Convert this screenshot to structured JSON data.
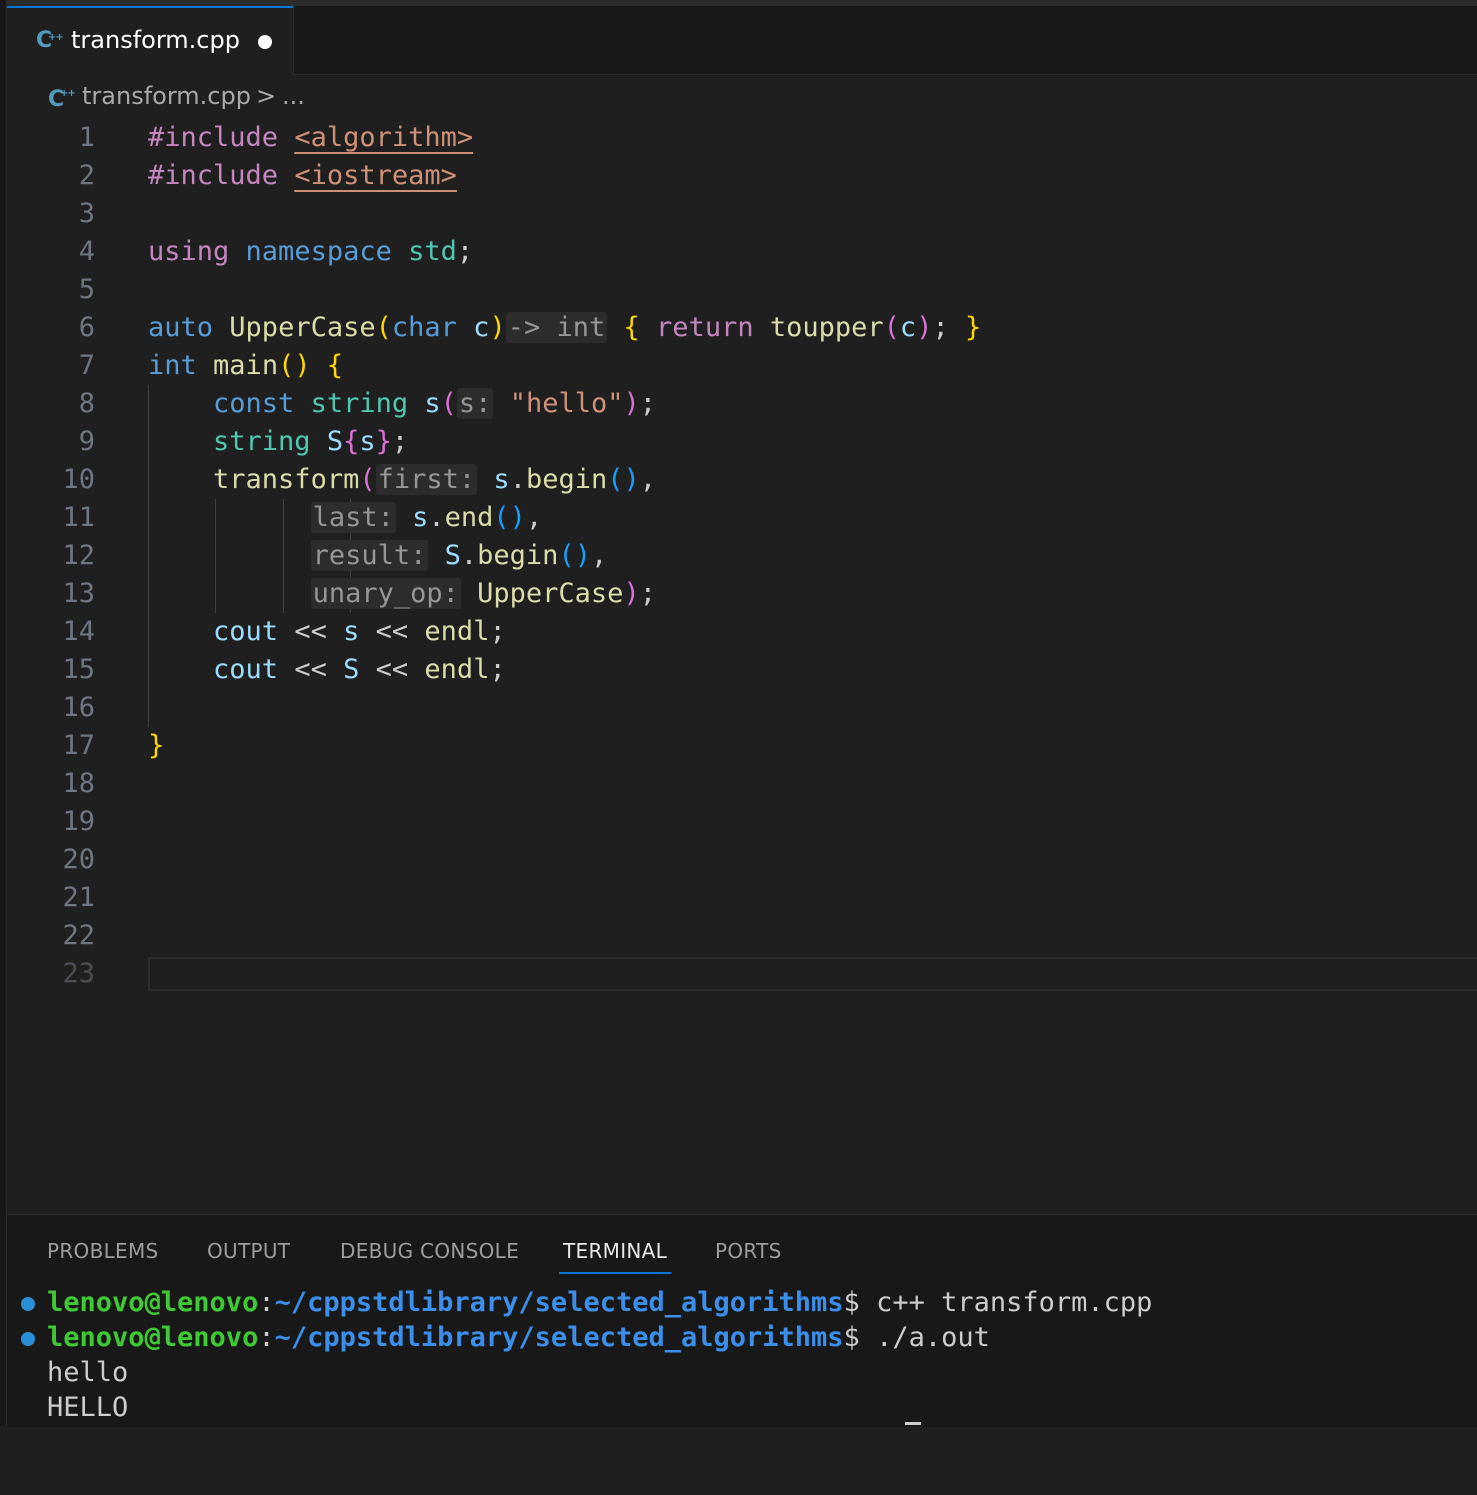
{
  "tab": {
    "label": "transform.cpp",
    "icon": "cpp-file-icon"
  },
  "breadcrumb": {
    "file": "transform.cpp",
    "separator": ">",
    "more": "..."
  },
  "line_numbers": [
    "1",
    "2",
    "3",
    "4",
    "5",
    "6",
    "7",
    "8",
    "9",
    "10",
    "11",
    "12",
    "13",
    "14",
    "15",
    "16",
    "17",
    "18",
    "19",
    "20",
    "21",
    "22",
    "23"
  ],
  "code": {
    "l1": {
      "kw": "#include",
      "inc": "<algorithm>"
    },
    "l2": {
      "kw": "#include",
      "inc": "<iostream>"
    },
    "l4": {
      "using": "using",
      "namespace": "namespace",
      "std": "std",
      "semi": ";"
    },
    "l6": {
      "auto": "auto",
      "fn": "UpperCase",
      "open": "(",
      "char": "char",
      "param": "c",
      "close": ")",
      "hint": "-> int",
      "brace_open": "{",
      "ret": "return",
      "call": "toupper",
      "call_open": "(",
      "arg": "c",
      "call_close": ")",
      "semi": ";",
      "brace_close": "}"
    },
    "l7": {
      "int": "int",
      "fn": "main",
      "parens": "()",
      "brace": "{"
    },
    "l8": {
      "const": "const",
      "type": "string",
      "var": "s",
      "open": "(",
      "hint": "s:",
      "str": "\"hello\"",
      "close": ")",
      "semi": ";"
    },
    "l9": {
      "type": "string",
      "var": "S",
      "open": "{",
      "arg": "s",
      "close": "}",
      "semi": ";"
    },
    "l10": {
      "fn": "transform",
      "open": "(",
      "hint": "first:",
      "obj": "s",
      "dot": ".",
      "method": "begin",
      "parens": "()",
      "comma": ","
    },
    "l11": {
      "hint": "last:",
      "obj": "s",
      "dot": ".",
      "method": "end",
      "parens": "()",
      "comma": ","
    },
    "l12": {
      "hint": "result:",
      "obj": "S",
      "dot": ".",
      "method": "begin",
      "parens": "()",
      "comma": ","
    },
    "l13": {
      "hint": "unary_op:",
      "fn": "UpperCase",
      "close": ")",
      "semi": ";"
    },
    "l14": {
      "cout": "cout",
      "op1": "<<",
      "var": "s",
      "op2": "<<",
      "endl": "endl",
      "semi": ";"
    },
    "l15": {
      "cout": "cout",
      "op1": "<<",
      "var": "S",
      "op2": "<<",
      "endl": "endl",
      "semi": ";"
    },
    "l17": {
      "brace": "}"
    }
  },
  "panel": {
    "tabs": [
      "PROBLEMS",
      "OUTPUT",
      "DEBUG CONSOLE",
      "TERMINAL",
      "PORTS"
    ],
    "active_tab": "TERMINAL"
  },
  "terminal": {
    "user": "lenovo@lenovo",
    "colon": ":",
    "path": "~/cppstdlibrary/selected_algorithms",
    "prompt": "$",
    "cmd1": " c++ transform.cpp",
    "cmd2": " ./a.out",
    "out1": "hello",
    "out2": "HELLO"
  },
  "colors": {
    "accent": "#0078d4",
    "keyword": "#569cd6",
    "control": "#c586c0",
    "type": "#4ec9b0",
    "function": "#dcdcaa",
    "string": "#ce9178",
    "terminal_user": "#3fc935",
    "terminal_path": "#3b8eea"
  }
}
